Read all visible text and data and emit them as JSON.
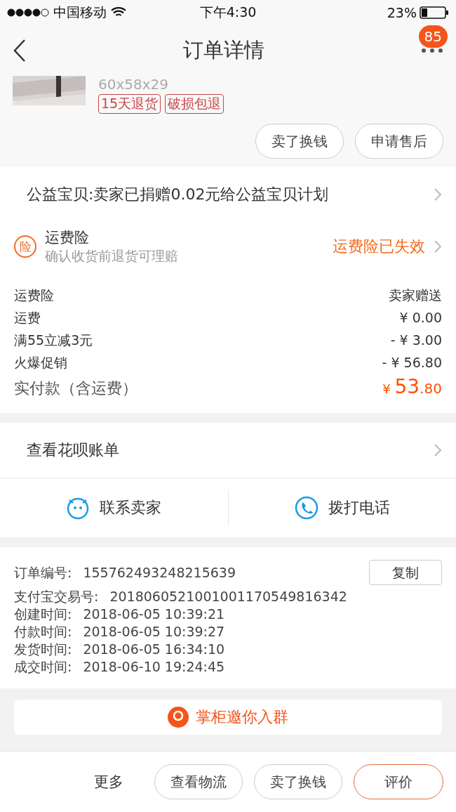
{
  "status_bar": {
    "carrier": "中国移动",
    "time": "下午4:30",
    "battery": "23%"
  },
  "nav": {
    "title": "订单详情",
    "badge": "85"
  },
  "product": {
    "size": "60x58x29",
    "tags": [
      "15天退货",
      "破损包退"
    ]
  },
  "product_actions": [
    "卖了换钱",
    "申请售后"
  ],
  "charity": {
    "text": "公益宝贝:卖家已捐赠0.02元给公益宝贝计划"
  },
  "insurance": {
    "icon_text": "险",
    "title": "运费险",
    "subtitle": "确认收货前退货可理赔",
    "status": "运费险已失效"
  },
  "price_rows": [
    {
      "label": "运费险",
      "value": "卖家赠送"
    },
    {
      "label": "运费",
      "value": "¥ 0.00"
    },
    {
      "label": "满55立减3元",
      "value": "- ¥ 3.00"
    },
    {
      "label": "火爆促销",
      "value": "- ¥ 56.80"
    }
  ],
  "total": {
    "label": "实付款（含运费）",
    "currency": "¥",
    "integer": "53",
    "decimal": ".80"
  },
  "huabei": {
    "label": "查看花呗账单"
  },
  "contact": [
    {
      "kind": "chat",
      "label": "联系卖家"
    },
    {
      "kind": "phone",
      "label": "拨打电话"
    }
  ],
  "order_info": {
    "order_no": {
      "label": "订单编号:",
      "value": "155762493248215639"
    },
    "copy_button": "复制",
    "rows": [
      {
        "label": "支付宝交易号:",
        "value": "2018060521001001170549816342"
      },
      {
        "label": "创建时间:",
        "value": "2018-06-05 10:39:21"
      },
      {
        "label": "付款时间:",
        "value": "2018-06-05 10:39:27"
      },
      {
        "label": "发货时间:",
        "value": "2018-06-05 16:34:10"
      },
      {
        "label": "成交时间:",
        "value": "2018-06-10 19:24:45"
      }
    ]
  },
  "group_card": {
    "text": "掌柜邀你入群"
  },
  "bottom_bar": {
    "more": "更多",
    "buttons": [
      {
        "label": "查看物流",
        "highlighted": false
      },
      {
        "label": "卖了换钱",
        "highlighted": false
      },
      {
        "label": "评价",
        "highlighted": true
      }
    ]
  }
}
